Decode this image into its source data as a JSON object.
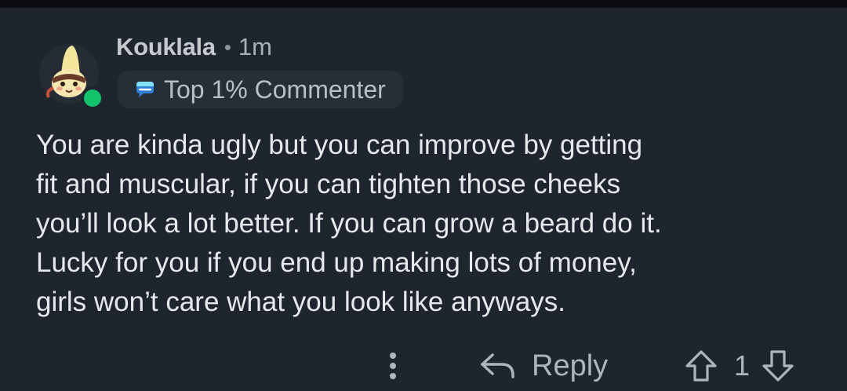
{
  "comment": {
    "username": "Kouklala",
    "separator": "•",
    "timestamp": "1m",
    "flair": "Top 1% Commenter",
    "body_lines": [
      "You are kinda ugly but you can improve by getting",
      "fit and muscular, if you can tighten those cheeks",
      "you’ll look a lot better. If you can grow a beard do it.",
      "Lucky for you if you end up making lots of money,",
      "girls won’t care what you look like anyways."
    ]
  },
  "actions": {
    "reply_label": "Reply",
    "score": "1"
  },
  "icons": {
    "avatar": "avatar-character",
    "online": "online-status-dot",
    "flair": "top-commenter-flair-icon",
    "more": "more-vertical-icon",
    "reply": "reply-arrow-icon",
    "upvote": "upvote-arrow-icon",
    "downvote": "downvote-arrow-icon"
  },
  "colors": {
    "background": "#1f252e",
    "online": "#0fc46a",
    "text": "#e6e9ec",
    "muted": "#aeb6bc"
  }
}
